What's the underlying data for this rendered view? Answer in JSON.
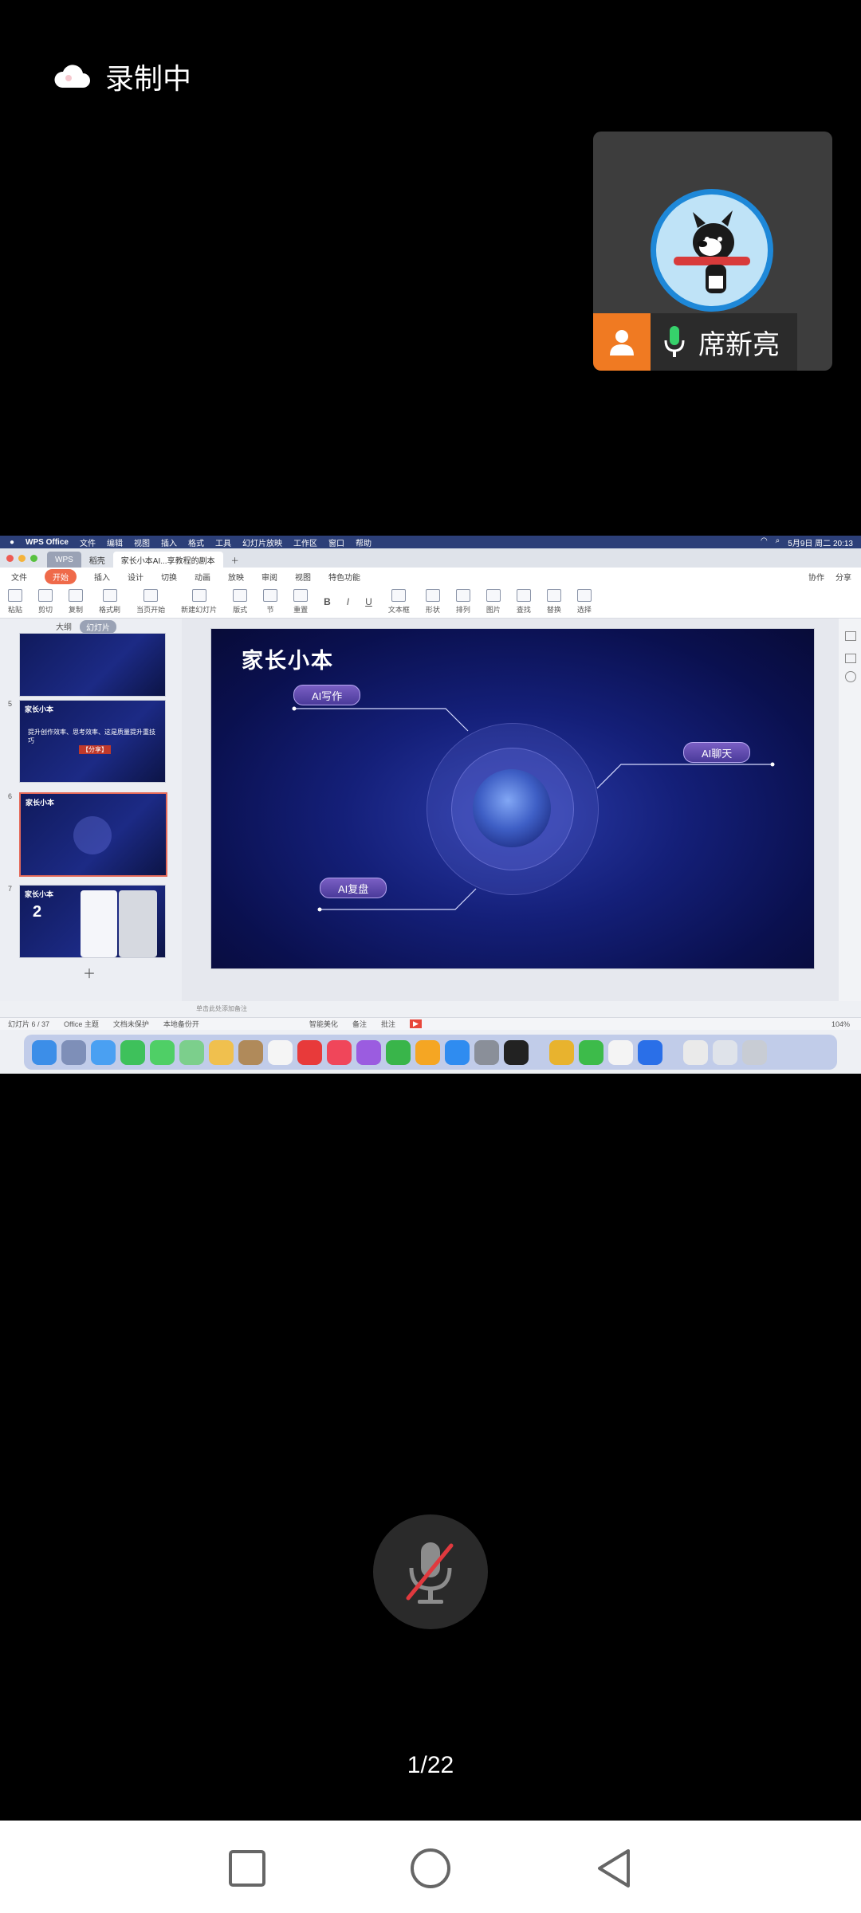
{
  "status": {
    "recording_label": "录制中"
  },
  "participant": {
    "name": "席新亮"
  },
  "shared_screen": {
    "menubar": {
      "items": [
        "WPS Office",
        "文件",
        "编辑",
        "视图",
        "插入",
        "格式",
        "工具",
        "幻灯片放映",
        "工作区",
        "窗口",
        "帮助"
      ],
      "datetime": "5月9日 周二 20:13"
    },
    "tabs": [
      "WPS",
      "稻壳",
      "家长小本AI...享教程的剧本"
    ],
    "ribbon_tabs": [
      "文件",
      "开始",
      "插入",
      "设计",
      "切换",
      "动画",
      "放映",
      "审阅",
      "视图",
      "特色功能"
    ],
    "ribbon_right": [
      "协作",
      "分享"
    ],
    "tools": [
      "粘贴",
      "剪切",
      "复制",
      "格式刷",
      "当页开始",
      "新建幻灯片",
      "版式",
      "节",
      "重置",
      "文本框",
      "形状",
      "排列",
      "图片",
      "查找",
      "替换",
      "选择"
    ],
    "left_panel": {
      "tabs": [
        "大纲",
        "幻灯片"
      ],
      "slide_numbers": [
        "5",
        "6",
        "7"
      ],
      "thumb5_title": "家长小本",
      "thumb5_text": "提升创作效率、思考效率、这是质量提升重技巧",
      "thumb5_tag": "【分享】",
      "thumb7_num": "2"
    },
    "slide": {
      "title": "家长小本",
      "pill_write": "AI写作",
      "pill_chat": "AI聊天",
      "pill_review": "AI复盘"
    },
    "notes_hint": "单击此处添加备注",
    "statusbar": {
      "slide_pos": "幻灯片 6 / 37",
      "theme": "Office 主题",
      "protect": "文档未保护",
      "backup": "本地备份开",
      "beautify": "智能美化",
      "notes": "备注",
      "comment": "批注",
      "zoom": "104%"
    }
  },
  "pager": {
    "label": "1/22"
  }
}
